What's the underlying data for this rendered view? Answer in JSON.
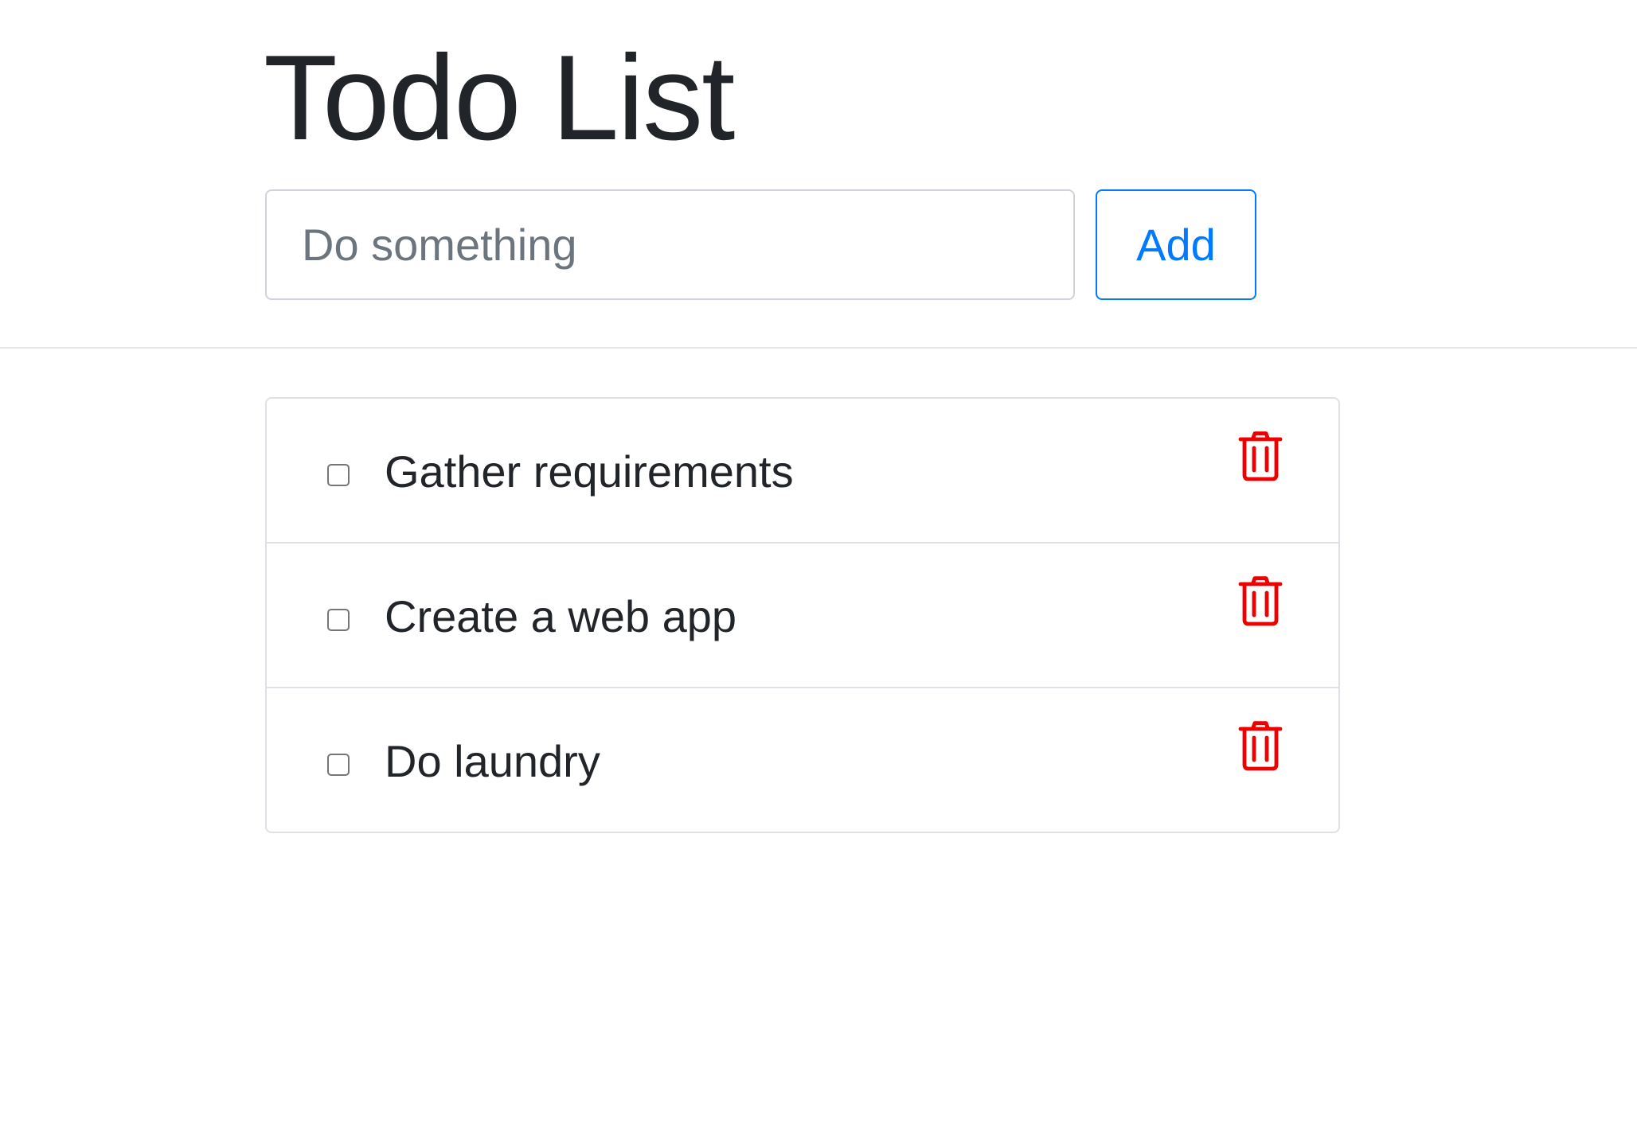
{
  "header": {
    "title": "Todo List"
  },
  "form": {
    "input_placeholder": "Do something",
    "input_value": "",
    "add_label": "Add"
  },
  "todos": [
    {
      "text": "Gather requirements",
      "done": false,
      "delete_icon": "trash-icon"
    },
    {
      "text": "Create a web app",
      "done": false,
      "delete_icon": "trash-icon"
    },
    {
      "text": "Do laundry",
      "done": false,
      "delete_icon": "trash-icon"
    }
  ],
  "colors": {
    "accent": "#007bff",
    "delete": "#ee0000",
    "text": "#212529",
    "border": "#dee2e6"
  }
}
